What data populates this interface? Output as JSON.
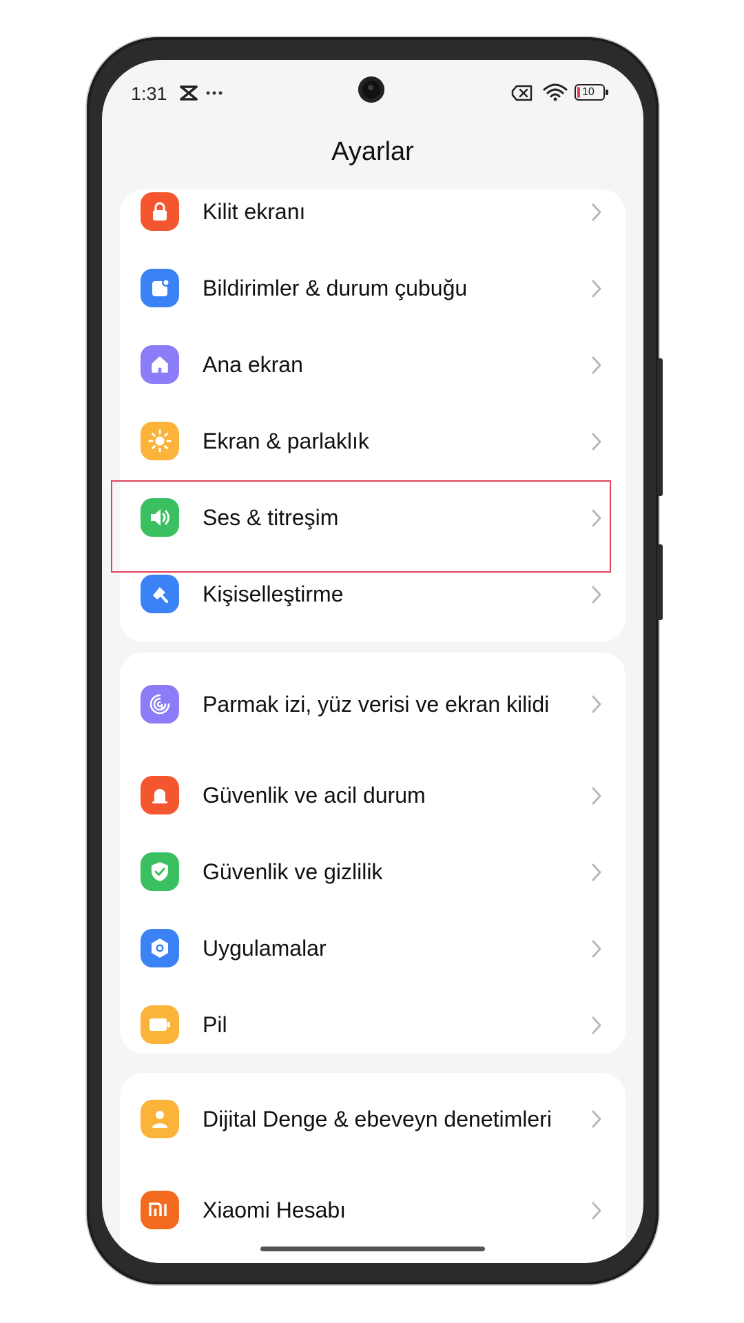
{
  "status": {
    "time": "1:31",
    "battery": "10"
  },
  "header": {
    "title": "Ayarlar"
  },
  "groups": [
    {
      "items": [
        {
          "label": "Kilit ekranı",
          "icon": "lock-icon",
          "color": "#f4572f"
        },
        {
          "label": "Bildirimler & durum çubuğu",
          "icon": "notification-icon",
          "color": "#3b82f6"
        },
        {
          "label": "Ana ekran",
          "icon": "home-icon",
          "color": "#8b7cf7"
        },
        {
          "label": "Ekran & parlaklık",
          "icon": "sun-icon",
          "color": "#fbb33a"
        },
        {
          "label": "Ses & titreşim",
          "icon": "speaker-icon",
          "color": "#3ac060",
          "highlighted": true
        },
        {
          "label": "Kişiselleştirme",
          "icon": "brush-icon",
          "color": "#3b82f6"
        }
      ]
    },
    {
      "items": [
        {
          "label": "Parmak izi, yüz verisi ve ekran kilidi",
          "icon": "fingerprint-icon",
          "color": "#8b7cf7"
        },
        {
          "label": "Güvenlik ve acil durum",
          "icon": "alert-icon",
          "color": "#f4572f"
        },
        {
          "label": "Güvenlik ve gizlilik",
          "icon": "shield-icon",
          "color": "#3ac060"
        },
        {
          "label": "Uygulamalar",
          "icon": "apps-icon",
          "color": "#3b82f6"
        },
        {
          "label": "Pil",
          "icon": "battery-icon",
          "color": "#fbb33a"
        }
      ]
    },
    {
      "items": [
        {
          "label": "Dijital Denge & ebeveyn denetimleri",
          "icon": "wellbeing-icon",
          "color": "#fbb33a"
        },
        {
          "label": "Xiaomi Hesabı",
          "icon": "mi-icon",
          "color": "#f46a1f"
        }
      ]
    }
  ]
}
